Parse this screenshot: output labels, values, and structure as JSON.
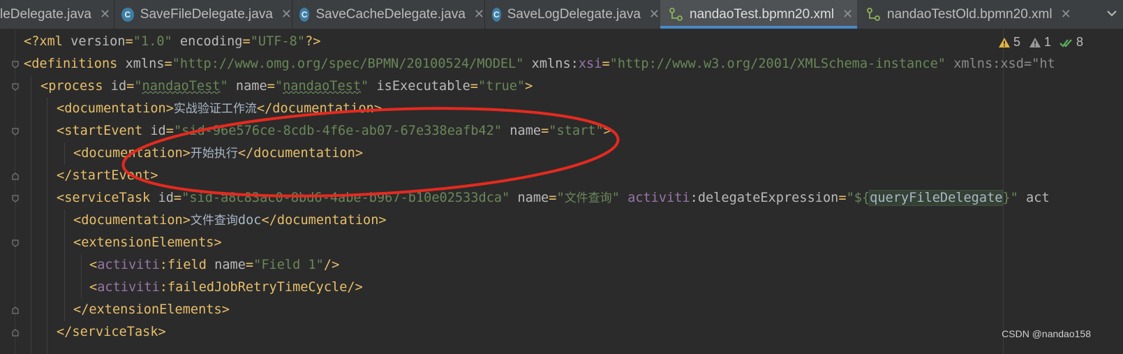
{
  "tabs": [
    {
      "label": "leDelegate.java",
      "icon": "class-icon",
      "close": "✕"
    },
    {
      "label": "SaveFileDelegate.java",
      "icon": "class-icon",
      "close": "✕"
    },
    {
      "label": "SaveCacheDelegate.java",
      "icon": "class-icon",
      "close": "✕"
    },
    {
      "label": "SaveLogDelegate.java",
      "icon": "class-icon",
      "close": "✕"
    },
    {
      "label": "nandaoTest.bpmn20.xml",
      "icon": "xml-tree-icon",
      "close": "✕",
      "active": true
    },
    {
      "label": "nandaoTestOld.bpmn20.xml",
      "icon": "xml-tree-icon",
      "close": "✕"
    }
  ],
  "class_icon_letter": "C",
  "tab_overflow_icon": "chevron-down-icon",
  "inspections": {
    "warnings": "5",
    "weak_warnings": "1",
    "ok": "8"
  },
  "code_lines": [
    [
      [
        "pi",
        "<?xml "
      ],
      [
        "attr",
        "version"
      ],
      [
        "pi",
        "="
      ],
      [
        "str",
        "\"1.0\""
      ],
      [
        "attr",
        " encoding"
      ],
      [
        "pi",
        "="
      ],
      [
        "str",
        "\"UTF-8\""
      ],
      [
        "pi",
        "?>"
      ]
    ],
    [
      [
        "tag",
        "<definitions "
      ],
      [
        "attr",
        "xmlns"
      ],
      [
        "tag",
        "="
      ],
      [
        "str",
        "\"http://www.omg.org/spec/BPMN/20100524/MODEL\""
      ],
      [
        "attr",
        " xmlns:"
      ],
      [
        "ns",
        "xsi"
      ],
      [
        "tag",
        "="
      ],
      [
        "str",
        "\"http://www.w3.org/2001/XMLSchema-instance\""
      ],
      [
        "dim",
        " xmlns:xsd=\"ht"
      ]
    ],
    [
      [
        "tag",
        "<process "
      ],
      [
        "attr",
        "id"
      ],
      [
        "tag",
        "="
      ],
      [
        "str",
        "\""
      ],
      [
        "strsq",
        "nandaoTest"
      ],
      [
        "str",
        "\""
      ],
      [
        "attr",
        " name"
      ],
      [
        "tag",
        "="
      ],
      [
        "str",
        "\""
      ],
      [
        "strsq",
        "nandaoTest"
      ],
      [
        "str",
        "\""
      ],
      [
        "attr",
        " isExecutable"
      ],
      [
        "tag",
        "="
      ],
      [
        "str",
        "\"true\""
      ],
      [
        "tag",
        ">"
      ]
    ],
    [
      [
        "tag",
        "<documentation>"
      ],
      [
        "cjk",
        "实战验证工作流"
      ],
      [
        "tag",
        "</documentation>"
      ]
    ],
    [
      [
        "tag",
        "<startEvent "
      ],
      [
        "attr",
        "id"
      ],
      [
        "tag",
        "="
      ],
      [
        "str",
        "\"sid-96e576ce-8cdb-4f6e-ab07-67e338eafb42\""
      ],
      [
        "attr",
        " name"
      ],
      [
        "tag",
        "="
      ],
      [
        "str",
        "\"start\""
      ],
      [
        "tag",
        ">"
      ]
    ],
    [
      [
        "tag",
        "<documentation>"
      ],
      [
        "cjk",
        "开始执行"
      ],
      [
        "tag",
        "</documentation>"
      ]
    ],
    [
      [
        "tag",
        "</startEvent>"
      ]
    ],
    [
      [
        "tag",
        "<serviceTask "
      ],
      [
        "attr",
        "id"
      ],
      [
        "tag",
        "="
      ],
      [
        "str",
        "\"sid-a8c83ac0-8bd6-4abe-b967-b10e02533dca\""
      ],
      [
        "attr",
        " name"
      ],
      [
        "tag",
        "="
      ],
      [
        "str",
        "\""
      ],
      [
        "cjkstr",
        "文件查询"
      ],
      [
        "str",
        "\""
      ],
      [
        "attr",
        " "
      ],
      [
        "ns",
        "activiti"
      ],
      [
        "attr",
        ":delegateExpression"
      ],
      [
        "tag",
        "="
      ],
      [
        "str",
        "\"${"
      ],
      [
        "hl",
        "queryFileDelegate"
      ],
      [
        "str",
        "}\""
      ],
      [
        "attr",
        " act"
      ]
    ],
    [
      [
        "tag",
        "<documentation>"
      ],
      [
        "cjk",
        "文件查询"
      ],
      [
        "txt",
        "doc"
      ],
      [
        "tag",
        "</documentation>"
      ]
    ],
    [
      [
        "tag",
        "<extensionElements>"
      ]
    ],
    [
      [
        "tag",
        "<"
      ],
      [
        "ns",
        "activiti"
      ],
      [
        "tag",
        ":field "
      ],
      [
        "attr",
        "name"
      ],
      [
        "tag",
        "="
      ],
      [
        "str",
        "\"Field 1\""
      ],
      [
        "tag",
        "/>"
      ]
    ],
    [
      [
        "tag",
        "<"
      ],
      [
        "ns",
        "activiti"
      ],
      [
        "tag",
        ":failedJobRetryTimeCycle/>"
      ]
    ],
    [
      [
        "tag",
        "</extensionElements>"
      ]
    ],
    [
      [
        "tag",
        "</serviceTask>"
      ]
    ]
  ],
  "watermark": "CSDN @nandao158",
  "colors": {
    "background": "#2b2b2b",
    "tag": "#e8bf6a",
    "string": "#6a8759",
    "namespace": "#9876aa",
    "annotation_ellipse": "#e52a1f"
  }
}
